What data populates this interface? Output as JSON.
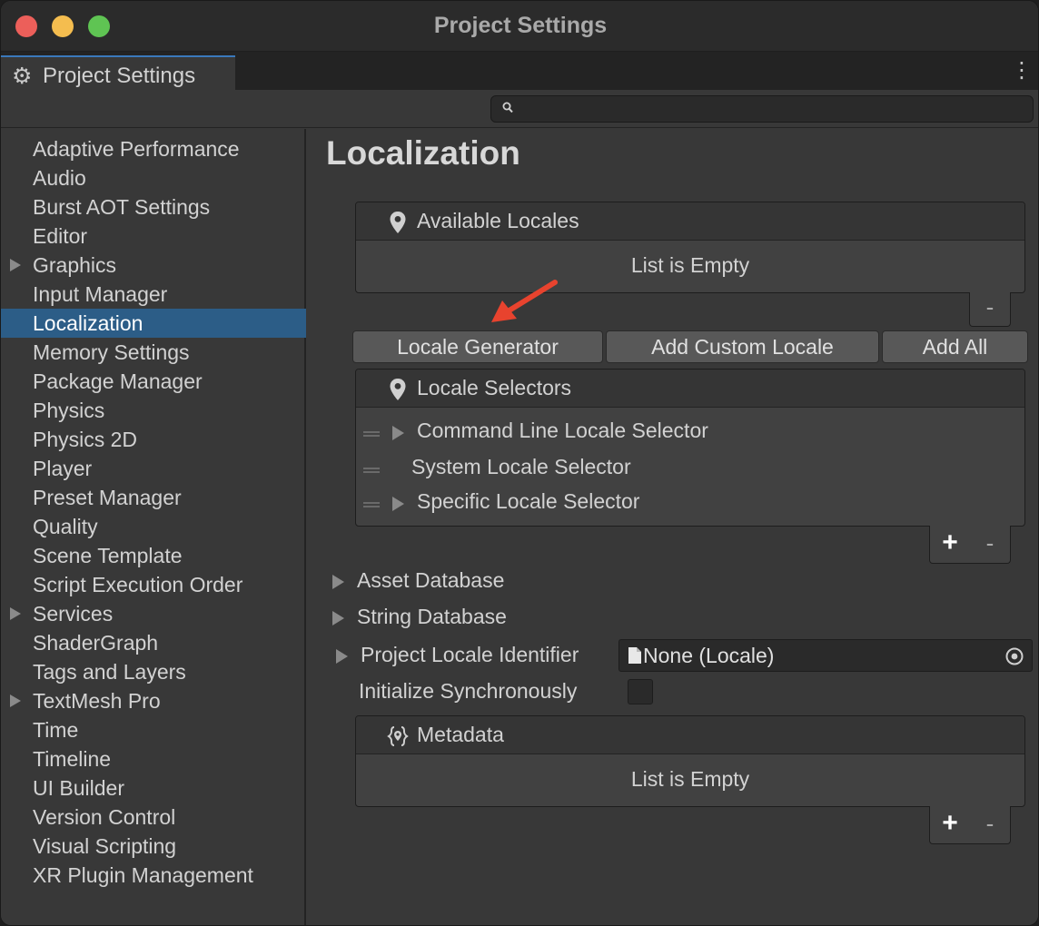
{
  "window": {
    "title": "Project Settings"
  },
  "tab": {
    "label": "Project Settings",
    "icon": "gear-icon"
  },
  "search": {
    "value": "",
    "icon": "search-icon"
  },
  "sidebar": {
    "items": [
      {
        "label": "Adaptive Performance",
        "expandable": false
      },
      {
        "label": "Audio",
        "expandable": false
      },
      {
        "label": "Burst AOT Settings",
        "expandable": false
      },
      {
        "label": "Editor",
        "expandable": false
      },
      {
        "label": "Graphics",
        "expandable": true
      },
      {
        "label": "Input Manager",
        "expandable": false
      },
      {
        "label": "Localization",
        "expandable": false,
        "selected": true
      },
      {
        "label": "Memory Settings",
        "expandable": false
      },
      {
        "label": "Package Manager",
        "expandable": false
      },
      {
        "label": "Physics",
        "expandable": false
      },
      {
        "label": "Physics 2D",
        "expandable": false
      },
      {
        "label": "Player",
        "expandable": false
      },
      {
        "label": "Preset Manager",
        "expandable": false
      },
      {
        "label": "Quality",
        "expandable": false
      },
      {
        "label": "Scene Template",
        "expandable": false
      },
      {
        "label": "Script Execution Order",
        "expandable": false
      },
      {
        "label": "Services",
        "expandable": true
      },
      {
        "label": "ShaderGraph",
        "expandable": false
      },
      {
        "label": "Tags and Layers",
        "expandable": false
      },
      {
        "label": "TextMesh Pro",
        "expandable": true
      },
      {
        "label": "Time",
        "expandable": false
      },
      {
        "label": "Timeline",
        "expandable": false
      },
      {
        "label": "UI Builder",
        "expandable": false
      },
      {
        "label": "Version Control",
        "expandable": false
      },
      {
        "label": "Visual Scripting",
        "expandable": false
      },
      {
        "label": "XR Plugin Management",
        "expandable": false
      }
    ]
  },
  "main": {
    "title": "Localization",
    "available_locales": {
      "header": "Available Locales",
      "empty_text": "List is Empty",
      "remove_label": "-"
    },
    "buttons": {
      "locale_generator": "Locale Generator",
      "add_custom_locale": "Add Custom Locale",
      "add_all": "Add All"
    },
    "locale_selectors": {
      "header": "Locale Selectors",
      "items": [
        {
          "label": "Command Line Locale Selector",
          "expandable": true
        },
        {
          "label": "System Locale Selector",
          "expandable": false
        },
        {
          "label": "Specific Locale Selector",
          "expandable": true
        }
      ],
      "add_label": "+",
      "remove_label": "-"
    },
    "properties": {
      "asset_database": "Asset Database",
      "string_database": "String Database",
      "project_locale_identifier": {
        "label": "Project Locale Identifier",
        "value": "None (Locale)"
      },
      "initialize_synchronously": {
        "label": "Initialize Synchronously",
        "checked": false
      }
    },
    "metadata": {
      "header": "Metadata",
      "empty_text": "List is Empty",
      "add_label": "+",
      "remove_label": "-"
    }
  },
  "colors": {
    "selection": "#2c5d87",
    "annotation_arrow": "#e8432e"
  }
}
